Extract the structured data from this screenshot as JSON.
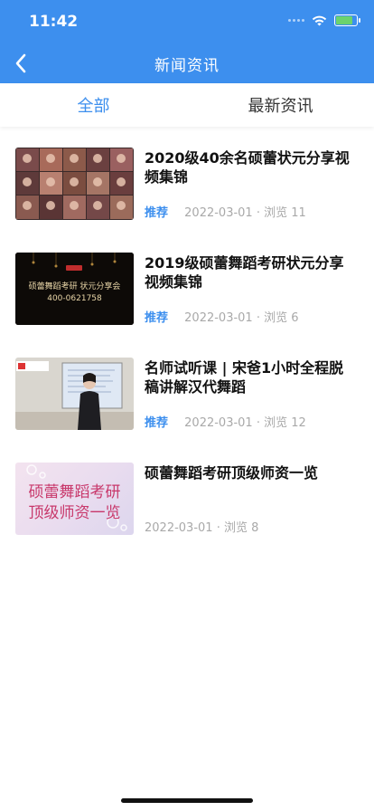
{
  "status_bar": {
    "time": "11:42"
  },
  "nav": {
    "title": "新闻资讯"
  },
  "tabs": [
    {
      "label": "全部",
      "active": true
    },
    {
      "label": "最新资讯",
      "active": false
    }
  ],
  "items": [
    {
      "title": "2020级40余名硕蕾状元分享视频集锦",
      "tag": "推荐",
      "date": "2022-03-01",
      "views": "浏览 11"
    },
    {
      "title": "2019级硕蕾舞蹈考研状元分享视频集锦",
      "tag": "推荐",
      "date": "2022-03-01",
      "views": "浏览 6",
      "thumb_text": "硕蕾舞蹈考研 状元分享会",
      "thumb_phone": "400-0621758"
    },
    {
      "title": "名师试听课 | 宋爸1小时全程脱稿讲解汉代舞蹈",
      "tag": "推荐",
      "date": "2022-03-01",
      "views": "浏览 12"
    },
    {
      "title": "硕蕾舞蹈考研顶级师资一览",
      "date": "2022-03-01",
      "views": "浏览 8",
      "thumb_line1": "硕蕾舞蹈考研",
      "thumb_line2": "顶级师资一览"
    }
  ],
  "colors": {
    "accent": "#3d8fee",
    "meta": "#a9a9a9"
  }
}
